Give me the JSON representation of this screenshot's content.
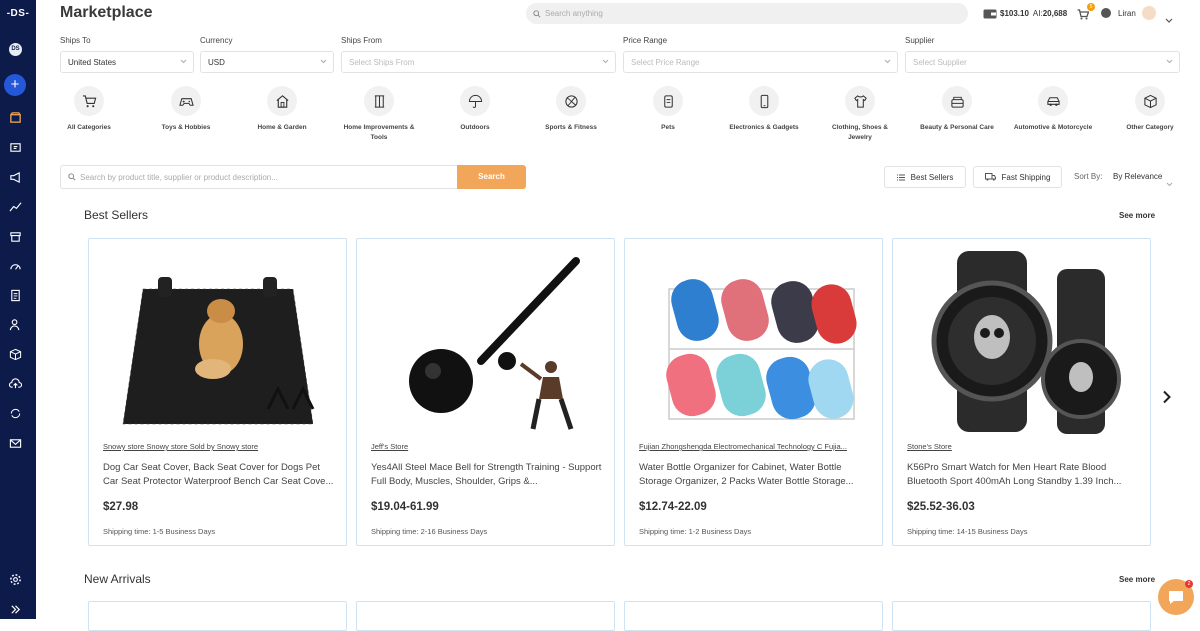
{
  "app": {
    "logo": "-DS-",
    "avatar_initials": "DS",
    "title": "Marketplace"
  },
  "header": {
    "search_placeholder": "Search anything",
    "balance": "$103.10",
    "ai_label": "AI:",
    "ai_value": "20,688",
    "cart_count": "5",
    "user_name": "Liran"
  },
  "filters": {
    "ships_to": {
      "label": "Ships To",
      "value": "United States"
    },
    "currency": {
      "label": "Currency",
      "value": "USD"
    },
    "ships_from": {
      "label": "Ships From",
      "placeholder": "Select Ships From"
    },
    "price_range": {
      "label": "Price Range",
      "placeholder": "Select Price Range"
    },
    "supplier": {
      "label": "Supplier",
      "placeholder": "Select Supplier"
    }
  },
  "categories": [
    {
      "label": "All Categories",
      "icon": "cart-icon"
    },
    {
      "label": "Toys & Hobbies",
      "icon": "gamepad-icon"
    },
    {
      "label": "Home & Garden",
      "icon": "house-icon"
    },
    {
      "label": "Home Improvements & Tools",
      "icon": "tools-icon"
    },
    {
      "label": "Outdoors",
      "icon": "umbrella-icon"
    },
    {
      "label": "Sports & Fitness",
      "icon": "ball-icon"
    },
    {
      "label": "Pets",
      "icon": "pet-icon"
    },
    {
      "label": "Electronics & Gadgets",
      "icon": "phone-icon"
    },
    {
      "label": "Clothing, Shoes & Jewelry",
      "icon": "shirt-icon"
    },
    {
      "label": "Beauty & Personal Care",
      "icon": "beauty-icon"
    },
    {
      "label": "Automotive & Motorcycle",
      "icon": "car-icon"
    },
    {
      "label": "Other Category",
      "icon": "box-icon"
    }
  ],
  "product_search": {
    "placeholder": "Search by product title, supplier or product description...",
    "button": "Search"
  },
  "toolbar": {
    "best_sellers": "Best Sellers",
    "fast_shipping": "Fast Shipping",
    "sort_label": "Sort By:",
    "sort_value": "By Relevance"
  },
  "best_sellers": {
    "title": "Best Sellers",
    "see_more": "See more",
    "products": [
      {
        "store": "Snowy store Snowy store Sold by Snowy store",
        "title": "Dog Car Seat Cover, Back Seat Cover for Dogs Pet Car Seat Protector Waterproof Bench Car Seat Cove...",
        "price": "$27.98",
        "shipping": "Shipping time: 1-5 Business Days"
      },
      {
        "store": "Jeff's Store",
        "title": "Yes4All Steel Mace Bell for Strength Training - Support Full Body, Muscles, Shoulder, Grips &...",
        "price": "$19.04-61.99",
        "shipping": "Shipping time: 2-16 Business Days"
      },
      {
        "store": "Fujian Zhongshengda Electromechanical Technology C Fujia...",
        "title": "Water Bottle Organizer for Cabinet, Water Bottle Storage Organizer, 2 Packs Water Bottle Storage...",
        "price": "$12.74-22.09",
        "shipping": "Shipping time: 1-2 Business Days"
      },
      {
        "store": "Stone's Store",
        "title": "K56Pro Smart Watch for Men Heart Rate Blood Bluetooth Sport 400mAh Long Standby 1.39 Inch...",
        "price": "$25.52-36.03",
        "shipping": "Shipping time: 14-15 Business Days"
      }
    ]
  },
  "new_arrivals": {
    "title": "New Arrivals",
    "see_more": "See more"
  },
  "chat": {
    "badge": "2"
  },
  "colors": {
    "sidebar": "#0d1b4a",
    "accent": "#f2a65a",
    "primary": "#2458d8",
    "card_border": "#cfe3f3"
  }
}
